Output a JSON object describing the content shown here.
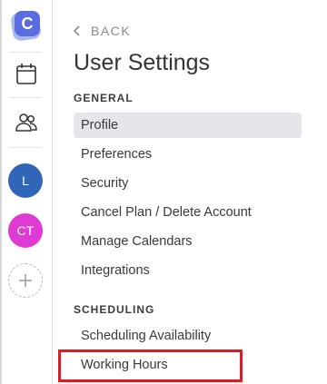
{
  "rail": {
    "logo_letter": "C",
    "avatars": [
      {
        "initials": "L",
        "color": "#2f66b8"
      },
      {
        "initials": "CT",
        "color": "#df3bd4"
      }
    ],
    "icons": [
      "calendar-icon",
      "people-icon",
      "plus-icon"
    ]
  },
  "header": {
    "back_label": "BACK",
    "title": "User Settings"
  },
  "sections": {
    "general": {
      "heading": "GENERAL",
      "items": [
        "Profile",
        "Preferences",
        "Security",
        "Cancel Plan / Delete Account",
        "Manage Calendars",
        "Integrations"
      ]
    },
    "scheduling": {
      "heading": "SCHEDULING",
      "items": [
        "Scheduling Availability",
        "Working Hours"
      ]
    }
  },
  "active_item": "Profile",
  "colors": {
    "brand": "#5b6ce0",
    "active_bg": "#e6e6ea",
    "highlight": "#e01b24"
  }
}
